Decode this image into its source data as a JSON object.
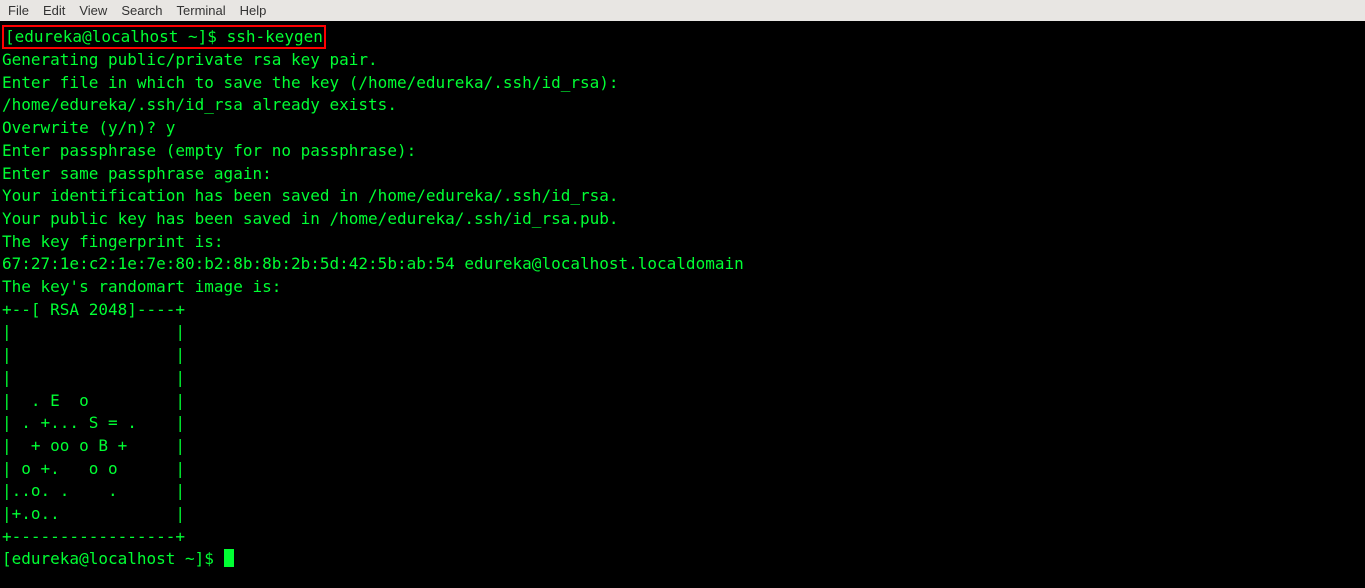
{
  "menubar": {
    "items": [
      "File",
      "Edit",
      "View",
      "Search",
      "Terminal",
      "Help"
    ]
  },
  "colors": {
    "terminal_bg": "#000000",
    "terminal_fg": "#00ff33",
    "highlight_border": "#ff0000",
    "menubar_bg": "#e8e6e3",
    "menubar_fg": "#333333"
  },
  "session": {
    "prompt_user_host": "[edureka@localhost ~]$",
    "command": "ssh-keygen",
    "output_lines": [
      "Generating public/private rsa key pair.",
      "Enter file in which to save the key (/home/edureka/.ssh/id_rsa):",
      "/home/edureka/.ssh/id_rsa already exists.",
      "Overwrite (y/n)? y",
      "Enter passphrase (empty for no passphrase):",
      "Enter same passphrase again:",
      "Your identification has been saved in /home/edureka/.ssh/id_rsa.",
      "Your public key has been saved in /home/edureka/.ssh/id_rsa.pub.",
      "The key fingerprint is:",
      "67:27:1e:c2:1e:7e:80:b2:8b:8b:2b:5d:42:5b:ab:54 edureka@localhost.localdomain",
      "The key's randomart image is:",
      "+--[ RSA 2048]----+",
      "|                 |",
      "|                 |",
      "|                 |",
      "|  . E  o         |",
      "| . +... S = .    |",
      "|  + oo o B +     |",
      "| o +.   o o      |",
      "|..o. .    .      |",
      "|+.o..            |",
      "+-----------------+"
    ],
    "final_prompt": "[edureka@localhost ~]$"
  }
}
